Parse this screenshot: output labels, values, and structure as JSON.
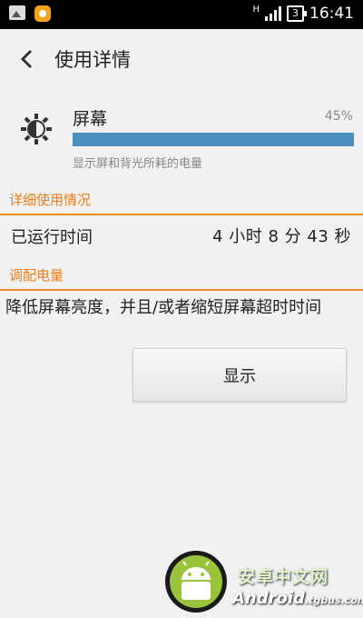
{
  "status_bar": {
    "network_letter": "H",
    "battery_level": "3",
    "time": "16:41",
    "left_icons": [
      "image-icon",
      "notification-icon"
    ]
  },
  "header": {
    "title": "使用详情"
  },
  "app": {
    "name": "屏幕",
    "percent_label": "45%",
    "usage_fraction": 1.0,
    "description": "显示屏和背光所耗的电量",
    "icon": "brightness-icon"
  },
  "details": {
    "section_title": "详细使用情况",
    "runtime_label": "已运行时间",
    "runtime_value": "4 小时 8 分 43 秒"
  },
  "adjust": {
    "section_title": "调配电量",
    "suggestion": "降低屏幕亮度，并且/或者缩短屏幕超时时间",
    "button_label": "显示"
  },
  "watermark": {
    "cn_text": "安卓中文网",
    "en_text": "Android",
    "en_suffix": ".tgbus.com"
  },
  "colors": {
    "accent": "#ef7d1a",
    "progress": "#4a8fbe",
    "background": "#f1f1f1"
  }
}
